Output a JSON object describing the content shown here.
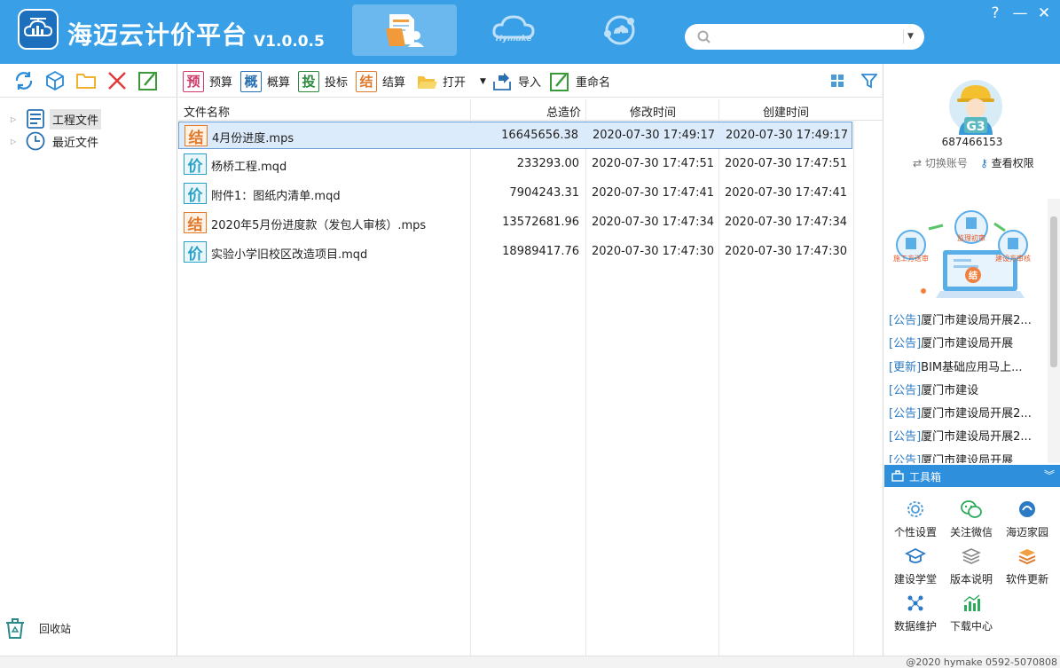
{
  "header": {
    "title": "海迈云计价平台",
    "version": "V1.0.0.5",
    "tabs": [
      {
        "name": "project-files",
        "active": true
      },
      {
        "name": "hymake",
        "label": "Hymake"
      },
      {
        "name": "cloud-sync"
      }
    ],
    "search": {
      "placeholder": ""
    },
    "help_label": "?",
    "minimize_label": "—",
    "close_label": "✕"
  },
  "left": {
    "tree": [
      {
        "label": "工程文件",
        "icon": "project-file-icon",
        "selected": true
      },
      {
        "label": "最近文件",
        "icon": "clock-icon",
        "selected": false
      }
    ],
    "recycle_label": "回收站"
  },
  "toolbar": {
    "budget": {
      "icon_char": "预",
      "label": "预算"
    },
    "estimate": {
      "icon_char": "概",
      "label": "概算"
    },
    "bid": {
      "icon_char": "投",
      "label": "投标"
    },
    "settle": {
      "icon_char": "结",
      "label": "结算"
    },
    "open_label": "打开",
    "import_label": "导入",
    "rename_label": "重命名"
  },
  "table": {
    "headers": [
      "文件名称",
      "总造价",
      "修改时间",
      "创建时间"
    ],
    "rows": [
      {
        "icon_char": "结",
        "type": "mps",
        "name": "4月份进度.mps",
        "cost": "16645656.38",
        "modified": "2020-07-30 17:49:17",
        "created": "2020-07-30 17:49:17",
        "selected": true
      },
      {
        "icon_char": "价",
        "type": "mqd",
        "name": "杨桥工程.mqd",
        "cost": "233293.00",
        "modified": "2020-07-30 17:47:51",
        "created": "2020-07-30 17:47:51"
      },
      {
        "icon_char": "价",
        "type": "mqd",
        "name": "附件1：图纸内清单.mqd",
        "cost": "7904243.31",
        "modified": "2020-07-30 17:47:41",
        "created": "2020-07-30 17:47:41"
      },
      {
        "icon_char": "结",
        "type": "mps",
        "name": "2020年5月份进度款（发包人审核）.mps",
        "cost": "13572681.96",
        "modified": "2020-07-30 17:47:34",
        "created": "2020-07-30 17:47:34"
      },
      {
        "icon_char": "价",
        "type": "mqd",
        "name": "实验小学旧校区改造项目.mqd",
        "cost": "18989417.76",
        "modified": "2020-07-30 17:47:30",
        "created": "2020-07-30 17:47:30"
      }
    ]
  },
  "right": {
    "badge": "G3",
    "user_id": "687466153",
    "switch_label": "切换账号",
    "perm_label": "查看权限",
    "promo": {
      "left": "施工方送审",
      "center": "监理初审",
      "right": "建设方审核",
      "core": "结"
    },
    "news": [
      {
        "tag": "[公告]",
        "text": "厦门市建设局开展2..."
      },
      {
        "tag": "[公告]",
        "text": "厦门市建设局开展"
      },
      {
        "tag": "[更新]",
        "text": "BIM基础应用马上..."
      },
      {
        "tag": "[公告]",
        "text": "厦门市建设"
      },
      {
        "tag": "[公告]",
        "text": "厦门市建设局开展2..."
      },
      {
        "tag": "[公告]",
        "text": "厦门市建设局开展2..."
      },
      {
        "tag": "[公告]",
        "text": "厦门市建设局开展"
      }
    ],
    "toolbox_title": "工具箱",
    "tools": [
      "个性设置",
      "关注微信",
      "海迈家园",
      "建设学堂",
      "版本说明",
      "软件更新",
      "数据维护",
      "下载中心"
    ]
  },
  "footer": {
    "copyright": "@2020 hymake 0592-5070808"
  },
  "colors": {
    "header_bg": "#39a0e8",
    "selection": "#dcebfb",
    "mps": "#e07a2e",
    "mqd": "#2aa2c8",
    "toolbox": "#2e8fdc"
  }
}
